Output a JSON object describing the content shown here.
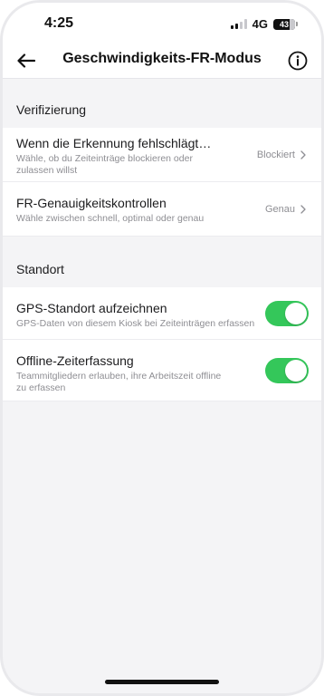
{
  "status_bar": {
    "time": "4:25",
    "network": "4G",
    "battery": "43"
  },
  "header": {
    "title": "Geschwindigkeits-FR-Modus",
    "back_icon": "arrow-left-icon",
    "info_icon": "info-icon"
  },
  "sections": [
    {
      "title": "Verifizierung",
      "rows": [
        {
          "title": "Wenn die Erkennung fehlschlägt…",
          "subtitle": "Wähle, ob du Zeiteinträge blockieren oder zulassen willst",
          "value": "Blockiert"
        },
        {
          "title": "FR-Genauigkeitskontrollen",
          "subtitle": "Wähle zwischen schnell, optimal oder genau",
          "value": "Genau"
        }
      ]
    },
    {
      "title": "Standort",
      "rows": [
        {
          "title": "GPS-Standort aufzeichnen",
          "subtitle": "GPS-Daten von diesem Kiosk bei Zeiteinträgen erfassen",
          "toggle_on": true
        },
        {
          "title": "Offline-Zeiterfassung",
          "subtitle": "Teammitgliedern erlauben, ihre Arbeitszeit offline zu erfassen",
          "toggle_on": true
        }
      ]
    }
  ],
  "colors": {
    "toggle_on": "#34c75a",
    "background": "#f4f4f6"
  }
}
